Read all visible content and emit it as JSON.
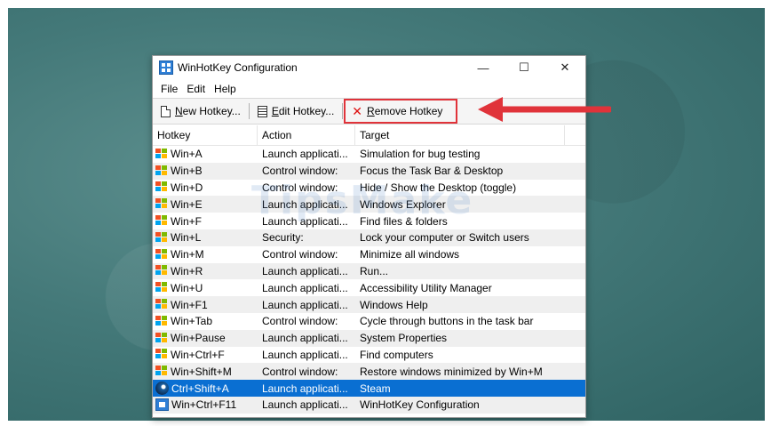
{
  "window": {
    "title": "WinHotKey Configuration",
    "controls": {
      "minimize": "—",
      "maximize": "☐",
      "close": "✕"
    }
  },
  "menu": [
    "File",
    "Edit",
    "Help"
  ],
  "toolbar": {
    "new_prefix": "N",
    "new_rest": "ew Hotkey...",
    "edit_prefix": "E",
    "edit_rest": "dit Hotkey...",
    "remove_prefix": "R",
    "remove_rest": "emove Hotkey"
  },
  "columns": [
    "Hotkey",
    "Action",
    "Target"
  ],
  "rows": [
    {
      "hotkey": "Win+A",
      "action": "Launch applicati...",
      "target": "Simulation for bug testing",
      "icon": "windows-flag-icon"
    },
    {
      "hotkey": "Win+B",
      "action": "Control window:",
      "target": "Focus the Task Bar & Desktop",
      "icon": "windows-flag-icon"
    },
    {
      "hotkey": "Win+D",
      "action": "Control window:",
      "target": "Hide / Show the Desktop (toggle)",
      "icon": "windows-flag-icon"
    },
    {
      "hotkey": "Win+E",
      "action": "Launch applicati...",
      "target": "Windows Explorer",
      "icon": "windows-flag-icon"
    },
    {
      "hotkey": "Win+F",
      "action": "Launch applicati...",
      "target": "Find files & folders",
      "icon": "windows-flag-icon"
    },
    {
      "hotkey": "Win+L",
      "action": "Security:",
      "target": "Lock your computer or Switch users",
      "icon": "windows-flag-icon"
    },
    {
      "hotkey": "Win+M",
      "action": "Control window:",
      "target": "Minimize all windows",
      "icon": "windows-flag-icon"
    },
    {
      "hotkey": "Win+R",
      "action": "Launch applicati...",
      "target": "Run...",
      "icon": "windows-flag-icon"
    },
    {
      "hotkey": "Win+U",
      "action": "Launch applicati...",
      "target": "Accessibility Utility Manager",
      "icon": "windows-flag-icon"
    },
    {
      "hotkey": "Win+F1",
      "action": "Launch applicati...",
      "target": "Windows Help",
      "icon": "windows-flag-icon"
    },
    {
      "hotkey": "Win+Tab",
      "action": "Control window:",
      "target": "Cycle through buttons in the task bar",
      "icon": "windows-flag-icon"
    },
    {
      "hotkey": "Win+Pause",
      "action": "Launch applicati...",
      "target": "System Properties",
      "icon": "windows-flag-icon"
    },
    {
      "hotkey": "Win+Ctrl+F",
      "action": "Launch applicati...",
      "target": "Find computers",
      "icon": "windows-flag-icon"
    },
    {
      "hotkey": "Win+Shift+M",
      "action": "Control window:",
      "target": "Restore windows minimized by Win+M",
      "icon": "windows-flag-icon"
    },
    {
      "hotkey": "Ctrl+Shift+A",
      "action": "Launch applicati...",
      "target": "Steam",
      "icon": "steam-icon",
      "selected": true
    },
    {
      "hotkey": "Win+Ctrl+F11",
      "action": "Launch applicati...",
      "target": "WinHotKey Configuration",
      "icon": "winhotkey-icon"
    }
  ],
  "watermark": "TipsMake",
  "colors": {
    "selection": "#0a6fd2",
    "annotation": "#e0333a",
    "desktop": "#447979"
  }
}
